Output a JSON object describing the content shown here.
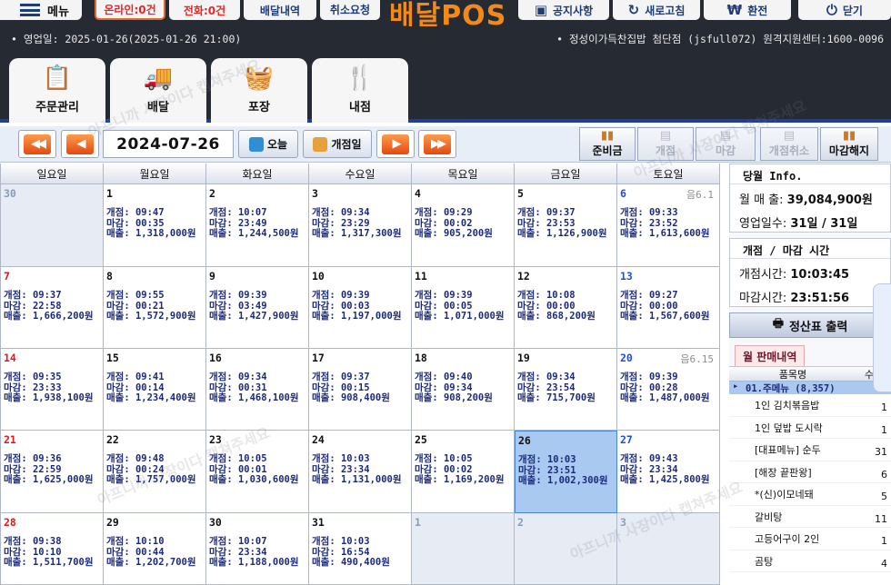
{
  "topbar": {
    "menu_label": "메뉴",
    "online_label": "온라인:0건",
    "phone_label": "전화:0건",
    "delivery_label": "배달내역",
    "cancel_label_1": "취소요청",
    "logo": "배달POS",
    "notice_label": "공지사항",
    "refresh_label": "새로고침",
    "exchange_label": "환전",
    "close_label": "닫기"
  },
  "infobar": {
    "left": "• 영업일: 2025-01-26(2025-01-26 21:00)",
    "right": "• 정성이가득찬집밥 첨단점 (jsfull072) 원격지원센터:1600-0096"
  },
  "tabs": [
    {
      "label": "주문관리",
      "icon": "clipboard-icon"
    },
    {
      "label": "배달",
      "icon": "truck-icon"
    },
    {
      "label": "포장",
      "icon": "basket-icon"
    },
    {
      "label": "내점",
      "icon": "utensils-icon"
    }
  ],
  "nav": {
    "date": "2024-07-26",
    "today_label": "오늘",
    "open_day_label": "개점일",
    "ops": [
      "준비금",
      "개점",
      "마감",
      "개점취소",
      "마감해지"
    ]
  },
  "calendar": {
    "weekdays": [
      "일요일",
      "월요일",
      "화요일",
      "수요일",
      "목요일",
      "금요일",
      "토요일"
    ],
    "weeks": [
      [
        {
          "day": "30",
          "other": true
        },
        {
          "day": "1",
          "open": "개점: 09:47",
          "close": "마감: 00:35",
          "sales": "매출: 1,318,000원"
        },
        {
          "day": "2",
          "open": "개점: 10:07",
          "close": "마감: 23:49",
          "sales": "매출: 1,244,500원"
        },
        {
          "day": "3",
          "open": "개점: 09:34",
          "close": "마감: 23:29",
          "sales": "매출: 1,317,300원"
        },
        {
          "day": "4",
          "open": "개점: 09:29",
          "close": "마감: 00:02",
          "sales": "매출: 905,200원"
        },
        {
          "day": "5",
          "open": "개점: 09:37",
          "close": "마감: 23:53",
          "sales": "매출: 1,126,900원"
        },
        {
          "day": "6",
          "note": "음6.1",
          "open": "개점: 09:33",
          "close": "마감: 23:52",
          "sales": "매출: 1,613,600원"
        }
      ],
      [
        {
          "day": "7",
          "open": "개점: 09:37",
          "close": "마감: 22:58",
          "sales": "매출: 1,666,200원"
        },
        {
          "day": "8",
          "open": "개점: 09:55",
          "close": "마감: 00:21",
          "sales": "매출: 1,572,900원"
        },
        {
          "day": "9",
          "open": "개점: 09:39",
          "close": "마감: 03:49",
          "sales": "매출: 1,427,900원"
        },
        {
          "day": "10",
          "open": "개점: 09:39",
          "close": "마감: 00:03",
          "sales": "매출: 1,197,000원"
        },
        {
          "day": "11",
          "open": "개점: 09:39",
          "close": "마감: 00:05",
          "sales": "매출: 1,071,000원"
        },
        {
          "day": "12",
          "open": "개점: 10:08",
          "close": "마감: 00:00",
          "sales": "매출: 868,200원"
        },
        {
          "day": "13",
          "open": "개점: 09:27",
          "close": "마감: 00:00",
          "sales": "매출: 1,567,600원"
        }
      ],
      [
        {
          "day": "14",
          "open": "개점: 09:35",
          "close": "마감: 23:33",
          "sales": "매출: 1,938,100원"
        },
        {
          "day": "15",
          "open": "개점: 09:41",
          "close": "마감: 00:14",
          "sales": "매출: 1,234,400원"
        },
        {
          "day": "16",
          "open": "개점: 09:34",
          "close": "마감: 00:31",
          "sales": "매출: 1,468,100원"
        },
        {
          "day": "17",
          "open": "개점: 09:37",
          "close": "마감: 00:15",
          "sales": "매출: 908,400원"
        },
        {
          "day": "18",
          "open": "개점: 09:40",
          "close": "마감: 09:34",
          "sales": "매출: 908,200원"
        },
        {
          "day": "19",
          "open": "개점: 09:34",
          "close": "마감: 23:54",
          "sales": "매출: 715,700원"
        },
        {
          "day": "20",
          "note": "음6.15",
          "open": "개점: 09:39",
          "close": "마감: 00:28",
          "sales": "매출: 1,487,000원"
        }
      ],
      [
        {
          "day": "21",
          "open": "개점: 09:36",
          "close": "마감: 22:59",
          "sales": "매출: 1,625,000원"
        },
        {
          "day": "22",
          "open": "개점: 09:48",
          "close": "마감: 00:24",
          "sales": "매출: 1,757,000원"
        },
        {
          "day": "23",
          "open": "개점: 10:05",
          "close": "마감: 00:01",
          "sales": "매출: 1,030,600원"
        },
        {
          "day": "24",
          "open": "개점: 10:03",
          "close": "마감: 23:34",
          "sales": "매출: 1,131,000원"
        },
        {
          "day": "25",
          "open": "개점: 10:05",
          "close": "마감: 00:02",
          "sales": "매출: 1,169,200원"
        },
        {
          "day": "26",
          "selected": true,
          "open": "개점: 10:03",
          "close": "마감: 23:51",
          "sales": "매출: 1,002,300원"
        },
        {
          "day": "27",
          "open": "개점: 09:43",
          "close": "마감: 23:34",
          "sales": "매출: 1,425,800원"
        }
      ],
      [
        {
          "day": "28",
          "open": "개점: 09:38",
          "close": "마감: 10:10",
          "sales": "매출: 1,511,700원"
        },
        {
          "day": "29",
          "open": "개점: 10:10",
          "close": "마감: 00:44",
          "sales": "매출: 1,202,700원"
        },
        {
          "day": "30",
          "open": "개점: 10:07",
          "close": "마감: 23:34",
          "sales": "매출: 1,188,000원"
        },
        {
          "day": "31",
          "open": "개점: 10:03",
          "close": "마감: 16:54",
          "sales": "매출: 490,400원"
        },
        {
          "day": "1",
          "other": true
        },
        {
          "day": "2",
          "other": true
        },
        {
          "day": "3",
          "other": true
        }
      ]
    ]
  },
  "right_panel": {
    "month_title": "당월 Info.",
    "month_sales_label": "월 매 출:",
    "month_sales_value": "39,084,900원",
    "days_label": "영업일수:",
    "days_value": "31일 / 31일",
    "time_title": "개점 / 마감 시간",
    "open_time_label": "개점시간:",
    "open_time_value": "10:03:45",
    "close_time_label": "마감시간:",
    "close_time_value": "23:51:56",
    "print_label": "정산표 출력",
    "sales_tab_label": "월 판매내역",
    "list_headers": [
      "품목명",
      "수량"
    ],
    "group_label": "01.주메뉴 (8,357)",
    "items": [
      {
        "name": "1인 김치볶음밥",
        "qty": "1"
      },
      {
        "name": "1인 덮밥 도시락",
        "qty": "1"
      },
      {
        "name": "[대표메뉴] 순두",
        "qty": "31"
      },
      {
        "name": "[해장 끝판왕]",
        "qty": "6"
      },
      {
        "name": "*(신)이모네돼",
        "qty": "5"
      },
      {
        "name": "갈비탕",
        "qty": "11"
      },
      {
        "name": "고등어구이 2인",
        "qty": "1"
      },
      {
        "name": "곰탕",
        "qty": "4"
      }
    ]
  },
  "watermarks": [
    "아프니까 사장이다 캡쳐주세요",
    "아프니까 사장이다 캡쳐주세요",
    "아프니까 사장이다 캡쳐주세요",
    "아프니까 사장이다 캡쳐주세요"
  ]
}
